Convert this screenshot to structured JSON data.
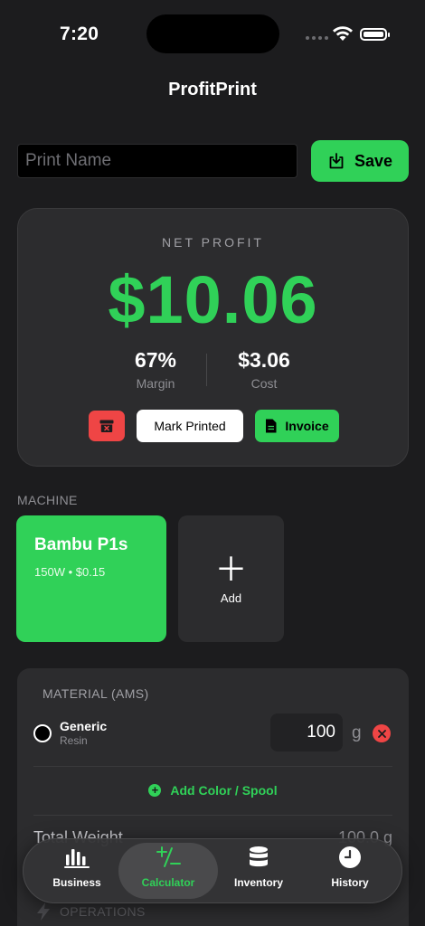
{
  "status_bar": {
    "time": "7:20"
  },
  "app": {
    "title": "ProfitPrint"
  },
  "print_name": {
    "placeholder": "Print Name",
    "value": ""
  },
  "save_button": {
    "label": "Save",
    "icon": "save-tray-icon"
  },
  "profit": {
    "label": "NET PROFIT",
    "value": "$10.06",
    "margin_value": "67%",
    "margin_label": "Margin",
    "cost_value": "$3.06",
    "cost_label": "Cost",
    "actions": {
      "delete_icon": "archive-x-icon",
      "mark_printed_label": "Mark Printed",
      "invoice_label": "Invoice",
      "invoice_icon": "document-icon"
    }
  },
  "machine": {
    "section_label": "MACHINE",
    "selected": {
      "name": "Bambu P1s",
      "spec": "150W • $0.15"
    },
    "add_label": "Add"
  },
  "material": {
    "section_label": "MATERIAL (AMS)",
    "items": [
      {
        "name": "Generic",
        "type": "Resin",
        "weight": "100",
        "unit": "g",
        "color": "#000000"
      }
    ],
    "add_color_label": "Add Color / Spool",
    "total_label": "Total Weight",
    "total_value": "100.0 g"
  },
  "operations": {
    "section_label": "OPERATIONS"
  },
  "tabs": [
    {
      "label": "Business",
      "icon": "bar-chart-icon",
      "active": false
    },
    {
      "label": "Calculator",
      "icon": "plus-minus-icon",
      "active": true
    },
    {
      "label": "Inventory",
      "icon": "database-icon",
      "active": false
    },
    {
      "label": "History",
      "icon": "clock-icon",
      "active": false
    }
  ],
  "colors": {
    "accent": "#30d158",
    "danger": "#ef4545",
    "background": "#1c1c1e",
    "card": "#2c2c2e"
  }
}
